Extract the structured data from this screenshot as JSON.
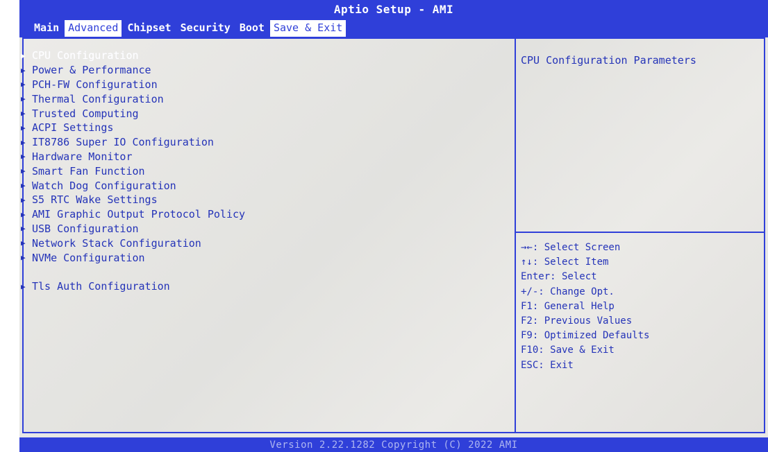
{
  "window": {
    "title": "Aptio Setup - AMI",
    "footer": "Version 2.22.1282 Copyright (C) 2022 AMI"
  },
  "tabs": [
    {
      "label": "Main"
    },
    {
      "label": "Advanced"
    },
    {
      "label": "Chipset"
    },
    {
      "label": "Security"
    },
    {
      "label": "Boot"
    },
    {
      "label": "Save & Exit"
    }
  ],
  "menu": [
    {
      "label": "CPU Configuration",
      "selected": true
    },
    {
      "label": "Power & Performance"
    },
    {
      "label": "PCH-FW Configuration"
    },
    {
      "label": "Thermal Configuration"
    },
    {
      "label": "Trusted Computing"
    },
    {
      "label": "ACPI Settings"
    },
    {
      "label": "IT8786 Super IO Configuration"
    },
    {
      "label": "Hardware Monitor"
    },
    {
      "label": "Smart Fan Function"
    },
    {
      "label": "Watch Dog Configuration"
    },
    {
      "label": "S5 RTC Wake Settings"
    },
    {
      "label": "AMI Graphic Output Protocol Policy"
    },
    {
      "label": "USB Configuration"
    },
    {
      "label": "Network Stack Configuration"
    },
    {
      "label": "NVMe Configuration"
    },
    {
      "label": "Tls Auth Configuration"
    }
  ],
  "help": {
    "description": "CPU Configuration Parameters"
  },
  "keys": [
    "→←: Select Screen",
    "↑↓: Select Item",
    "Enter: Select",
    "+/-: Change Opt.",
    "F1: General Help",
    "F2: Previous Values",
    "F9: Optimized Defaults",
    "F10: Save & Exit",
    "ESC: Exit"
  ],
  "colors": {
    "accent": "#2f3fd9",
    "text": "#2433b8",
    "background": "#e7e7e5"
  }
}
